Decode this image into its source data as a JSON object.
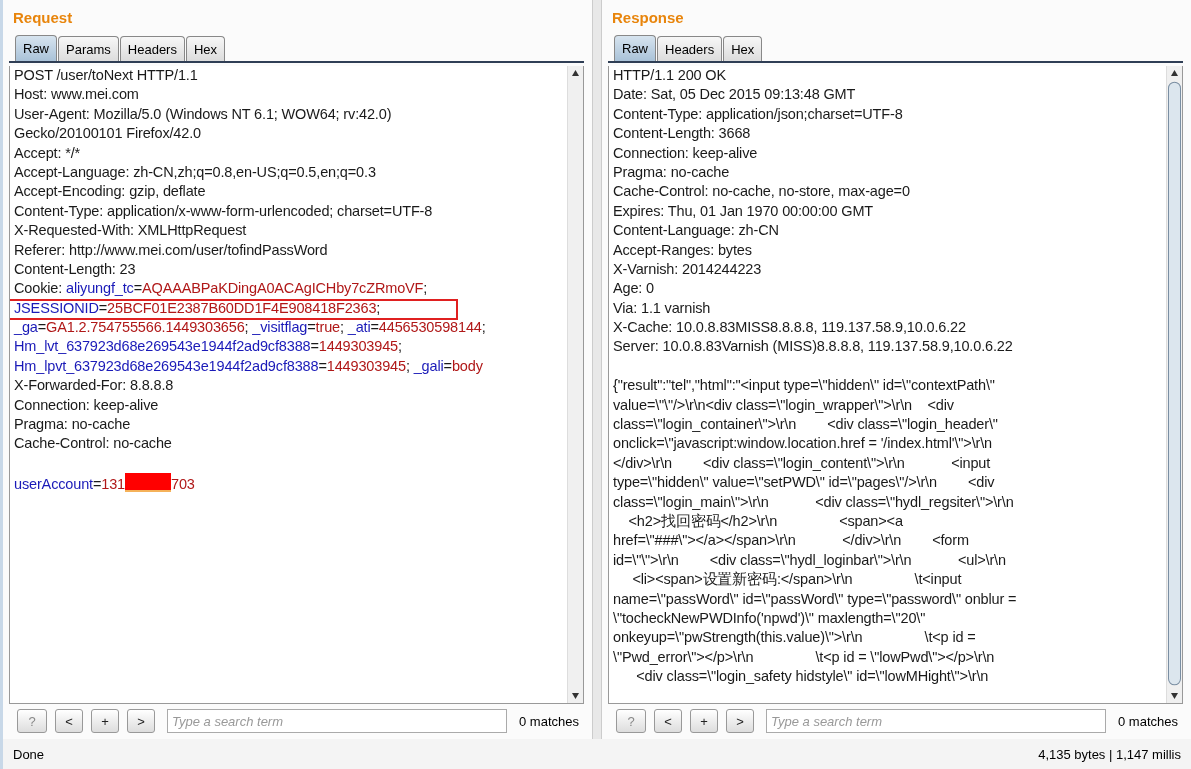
{
  "panes": [
    {
      "title": "Request",
      "tabs": [
        {
          "label": "Raw",
          "selected": true
        },
        {
          "label": "Params",
          "selected": false
        },
        {
          "label": "Headers",
          "selected": false
        },
        {
          "label": "Hex",
          "selected": false
        }
      ],
      "lines": [
        {
          "segments": [
            {
              "kind": "plain",
              "text": "POST /user/toNext HTTP/1.1"
            }
          ]
        },
        {
          "segments": [
            {
              "kind": "plain",
              "text": "Host: www.mei.com"
            }
          ]
        },
        {
          "segments": [
            {
              "kind": "plain",
              "text": "User-Agent: Mozilla/5.0 (Windows NT 6.1; WOW64; rv:42.0)"
            }
          ]
        },
        {
          "segments": [
            {
              "kind": "plain",
              "text": "Gecko/20100101 Firefox/42.0"
            }
          ]
        },
        {
          "segments": [
            {
              "kind": "plain",
              "text": "Accept: */*"
            }
          ]
        },
        {
          "segments": [
            {
              "kind": "plain",
              "text": "Accept-Language: zh-CN,zh;q=0.8,en-US;q=0.5,en;q=0.3"
            }
          ]
        },
        {
          "segments": [
            {
              "kind": "plain",
              "text": "Accept-Encoding: gzip, deflate"
            }
          ]
        },
        {
          "segments": [
            {
              "kind": "plain",
              "text": "Content-Type: application/x-www-form-urlencoded; charset=UTF-8"
            }
          ]
        },
        {
          "segments": [
            {
              "kind": "plain",
              "text": "X-Requested-With: XMLHttpRequest"
            }
          ]
        },
        {
          "segments": [
            {
              "kind": "plain",
              "text": "Referer: http://www.mei.com/user/tofindPassWord"
            }
          ]
        },
        {
          "segments": [
            {
              "kind": "plain",
              "text": "Content-Length: 23"
            }
          ]
        },
        {
          "segments": [
            {
              "kind": "plain",
              "text": "Cookie: "
            },
            {
              "kind": "key",
              "text": "aliyungf_tc"
            },
            {
              "kind": "plain",
              "text": "="
            },
            {
              "kind": "value",
              "text": "AQAAABPaKDingA0ACAgICHby7cZRmoVF"
            },
            {
              "kind": "plain",
              "text": ";"
            }
          ]
        },
        {
          "highlighted": true,
          "segments": [
            {
              "kind": "key",
              "text": "JSESSIONID"
            },
            {
              "kind": "plain",
              "text": "="
            },
            {
              "kind": "value",
              "text": "25BCF01E2387B60DD1F4E908418F2363"
            },
            {
              "kind": "plain",
              "text": ";"
            }
          ]
        },
        {
          "segments": [
            {
              "kind": "key",
              "text": "_ga"
            },
            {
              "kind": "plain",
              "text": "="
            },
            {
              "kind": "value",
              "text": "GA1.2.754755566.1449303656"
            },
            {
              "kind": "plain",
              "text": "; "
            },
            {
              "kind": "key",
              "text": "_visitflag"
            },
            {
              "kind": "plain",
              "text": "="
            },
            {
              "kind": "value",
              "text": "true"
            },
            {
              "kind": "plain",
              "text": "; "
            },
            {
              "kind": "key",
              "text": "_ati"
            },
            {
              "kind": "plain",
              "text": "="
            },
            {
              "kind": "value",
              "text": "4456530598144"
            },
            {
              "kind": "plain",
              "text": ";"
            }
          ]
        },
        {
          "segments": [
            {
              "kind": "key",
              "text": "Hm_lvt_637923d68e269543e1944f2ad9cf8388"
            },
            {
              "kind": "plain",
              "text": "="
            },
            {
              "kind": "value",
              "text": "1449303945"
            },
            {
              "kind": "plain",
              "text": ";"
            }
          ]
        },
        {
          "segments": [
            {
              "kind": "key",
              "text": "Hm_lpvt_637923d68e269543e1944f2ad9cf8388"
            },
            {
              "kind": "plain",
              "text": "="
            },
            {
              "kind": "value",
              "text": "1449303945"
            },
            {
              "kind": "plain",
              "text": "; "
            },
            {
              "kind": "key",
              "text": "_gali"
            },
            {
              "kind": "plain",
              "text": "="
            },
            {
              "kind": "value",
              "text": "body"
            }
          ]
        },
        {
          "segments": [
            {
              "kind": "plain",
              "text": "X-Forwarded-For: 8.8.8.8"
            }
          ]
        },
        {
          "segments": [
            {
              "kind": "plain",
              "text": "Connection: keep-alive"
            }
          ]
        },
        {
          "segments": [
            {
              "kind": "plain",
              "text": "Pragma: no-cache"
            }
          ]
        },
        {
          "segments": [
            {
              "kind": "plain",
              "text": "Cache-Control: no-cache"
            }
          ]
        },
        {
          "space_before": true,
          "segments": [
            {
              "kind": "key",
              "text": "userAccount"
            },
            {
              "kind": "plain",
              "text": "="
            },
            {
              "kind": "value",
              "text": "131"
            },
            {
              "kind": "redaction"
            },
            {
              "kind": "value",
              "text": "703"
            }
          ]
        }
      ],
      "search": {
        "placeholder": "Type a search term",
        "buttons": [
          "?",
          "<",
          "+",
          ">"
        ],
        "matches": "0 matches"
      }
    },
    {
      "title": "Response",
      "tabs": [
        {
          "label": "Raw",
          "selected": true
        },
        {
          "label": "Headers",
          "selected": false
        },
        {
          "label": "Hex",
          "selected": false
        }
      ],
      "lines": [
        {
          "segments": [
            {
              "kind": "plain",
              "text": "HTTP/1.1 200 OK"
            }
          ]
        },
        {
          "segments": [
            {
              "kind": "plain",
              "text": "Date: Sat, 05 Dec 2015 09:13:48 GMT"
            }
          ]
        },
        {
          "segments": [
            {
              "kind": "plain",
              "text": "Content-Type: application/json;charset=UTF-8"
            }
          ]
        },
        {
          "segments": [
            {
              "kind": "plain",
              "text": "Content-Length: 3668"
            }
          ]
        },
        {
          "segments": [
            {
              "kind": "plain",
              "text": "Connection: keep-alive"
            }
          ]
        },
        {
          "segments": [
            {
              "kind": "plain",
              "text": "Pragma: no-cache"
            }
          ]
        },
        {
          "segments": [
            {
              "kind": "plain",
              "text": "Cache-Control: no-cache, no-store, max-age=0"
            }
          ]
        },
        {
          "segments": [
            {
              "kind": "plain",
              "text": "Expires: Thu, 01 Jan 1970 00:00:00 GMT"
            }
          ]
        },
        {
          "segments": [
            {
              "kind": "plain",
              "text": "Content-Language: zh-CN"
            }
          ]
        },
        {
          "segments": [
            {
              "kind": "plain",
              "text": "Accept-Ranges: bytes"
            }
          ]
        },
        {
          "segments": [
            {
              "kind": "plain",
              "text": "X-Varnish: 2014244223"
            }
          ]
        },
        {
          "segments": [
            {
              "kind": "plain",
              "text": "Age: 0"
            }
          ]
        },
        {
          "segments": [
            {
              "kind": "plain",
              "text": "Via: 1.1 varnish"
            }
          ]
        },
        {
          "segments": [
            {
              "kind": "plain",
              "text": "X-Cache: 10.0.8.83MISS8.8.8.8, 119.137.58.9,10.0.6.22"
            }
          ]
        },
        {
          "segments": [
            {
              "kind": "plain",
              "text": "Server: 10.0.8.83Varnish (MISS)8.8.8.8, 119.137.58.9,10.0.6.22"
            }
          ]
        },
        {
          "space_before": true,
          "segments": [
            {
              "kind": "plain",
              "text": "{\"result\":\"tel\",\"html\":\"<input type=\\\"hidden\\\" id=\\\"contextPath\\\""
            }
          ]
        },
        {
          "segments": [
            {
              "kind": "plain",
              "text": "value=\\\"\\\"/>\\r\\n<div class=\\\"login_wrapper\\\">\\r\\n    <div"
            }
          ]
        },
        {
          "segments": [
            {
              "kind": "plain",
              "text": "class=\\\"login_container\\\">\\r\\n        <div class=\\\"login_header\\\""
            }
          ]
        },
        {
          "segments": [
            {
              "kind": "plain",
              "text": "onclick=\\\"javascript:window.location.href = '/index.html'\\\">\\r\\n"
            }
          ]
        },
        {
          "segments": [
            {
              "kind": "plain",
              "text": "</div>\\r\\n        <div class=\\\"login_content\\\">\\r\\n            <input"
            }
          ]
        },
        {
          "segments": [
            {
              "kind": "plain",
              "text": "type=\\\"hidden\\\" value=\\\"setPWD\\\" id=\\\"pages\\\"/>\\r\\n        <div"
            }
          ]
        },
        {
          "segments": [
            {
              "kind": "plain",
              "text": "class=\\\"login_main\\\">\\r\\n            <div class=\\\"hydl_regsiter\\\">\\r\\n"
            }
          ]
        },
        {
          "segments": [
            {
              "kind": "plain",
              "text": "    <h2>找回密码</h2>\\r\\n                <span><a"
            }
          ]
        },
        {
          "segments": [
            {
              "kind": "plain",
              "text": "href=\\\"###\\\"></a></span>\\r\\n            </div>\\r\\n        <form"
            }
          ]
        },
        {
          "segments": [
            {
              "kind": "plain",
              "text": "id=\\\"\\\">\\r\\n        <div class=\\\"hydl_loginbar\\\">\\r\\n            <ul>\\r\\n"
            }
          ]
        },
        {
          "segments": [
            {
              "kind": "plain",
              "text": "     <li><span>设置新密码:</span>\\r\\n                \\t<input"
            }
          ]
        },
        {
          "segments": [
            {
              "kind": "plain",
              "text": "name=\\\"passWord\\\" id=\\\"passWord\\\" type=\\\"password\\\" onblur ="
            }
          ]
        },
        {
          "segments": [
            {
              "kind": "plain",
              "text": "\\\"tocheckNewPWDInfo('npwd')\\\" maxlength=\\\"20\\\""
            }
          ]
        },
        {
          "segments": [
            {
              "kind": "plain",
              "text": "onkeyup=\\\"pwStrength(this.value)\\\">\\r\\n                \\t<p id ="
            }
          ]
        },
        {
          "segments": [
            {
              "kind": "plain",
              "text": "\\\"Pwd_error\\\"></p>\\r\\n                \\t<p id = \\\"lowPwd\\\"></p>\\r\\n"
            }
          ]
        },
        {
          "segments": [
            {
              "kind": "plain",
              "text": "      <div class=\\\"login_safety hidstyle\\\" id=\\\"lowMHight\\\">\\r\\n"
            }
          ]
        }
      ],
      "search": {
        "placeholder": "Type a search term",
        "buttons": [
          "?",
          "<",
          "+",
          ">"
        ],
        "matches": "0 matches"
      }
    }
  ],
  "status_bar": {
    "left": "Done",
    "right": "4,135 bytes | 1,147 millis"
  }
}
